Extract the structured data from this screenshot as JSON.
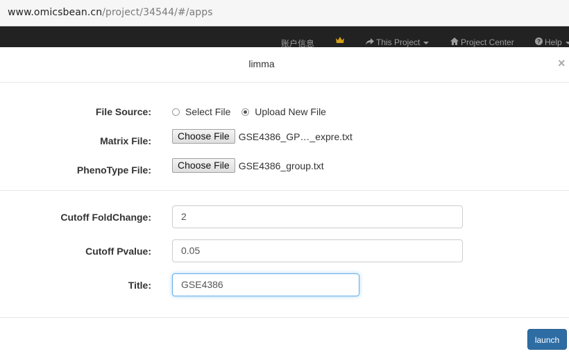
{
  "browser": {
    "url_host": "www.omicsbean.cn",
    "url_path": "/project/34544/#/apps"
  },
  "navbar": {
    "account_label": "账户信息",
    "crown_icon": "crown-icon",
    "this_project_label": "This Project",
    "project_center_label": "Project Center",
    "help_label": "Help"
  },
  "modal": {
    "title": "limma",
    "close_glyph": "×",
    "file_source": {
      "label": "File Source:",
      "options": [
        "Select File",
        "Upload New File"
      ],
      "selected": "Upload New File"
    },
    "matrix_file": {
      "label": "Matrix File:",
      "button": "Choose File",
      "filename": "GSE4386_GP…_expre.txt"
    },
    "phenotype_file": {
      "label": "PhenoType File:",
      "button": "Choose File",
      "filename": "GSE4386_group.txt"
    },
    "cutoff_foldchange": {
      "label": "Cutoff FoldChange:",
      "value": "2"
    },
    "cutoff_pvalue": {
      "label": "Cutoff Pvalue:",
      "value": "0.05"
    },
    "title_field": {
      "label": "Title:",
      "value": "GSE4386"
    },
    "launch_label": "launch"
  },
  "colors": {
    "navbar_bg": "#222222",
    "primary_button": "#2e6da4",
    "focus_border": "#66afe9"
  }
}
